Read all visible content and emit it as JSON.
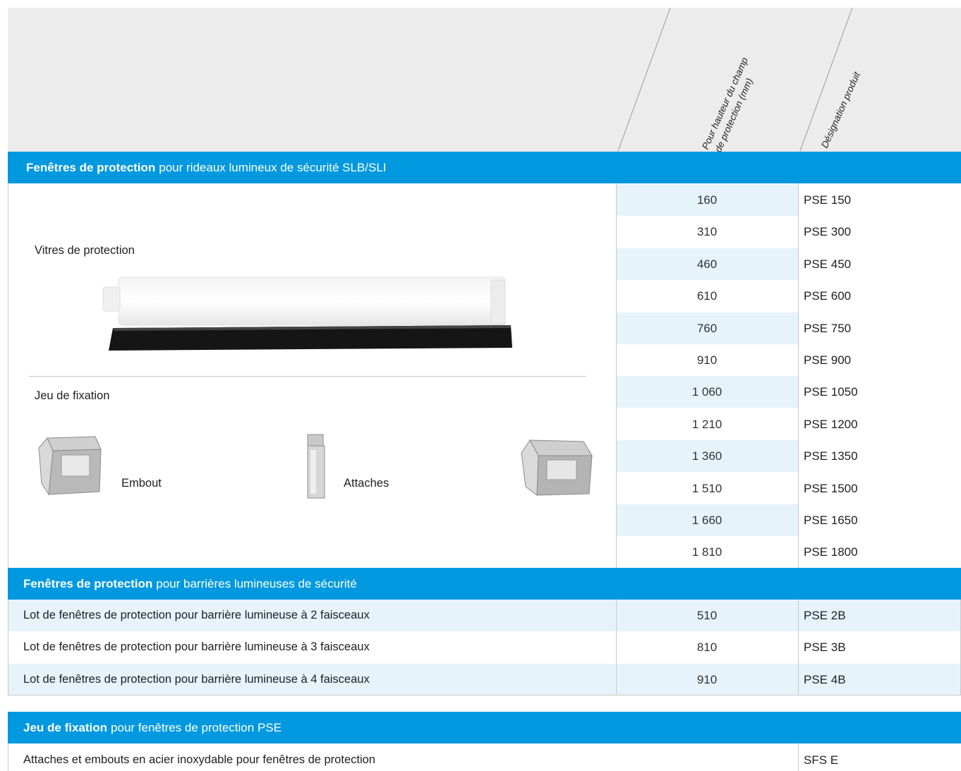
{
  "header": {
    "col_height_line1": "Pour hauteur du champ",
    "col_height_line2": "de protection (mm)",
    "col_designation": "Désignation produit"
  },
  "section1": {
    "title_bold": "Fenêtres de protection",
    "title_rest": "pour rideaux lumineux de sécurité SLB/SLI",
    "vitres_label": "Vitres de protection",
    "fixation_label": "Jeu de fixation",
    "embout_label": "Embout",
    "attaches_label": "Attaches",
    "rows": [
      {
        "height": "160",
        "code": "PSE 150"
      },
      {
        "height": "310",
        "code": "PSE 300"
      },
      {
        "height": "460",
        "code": "PSE 450"
      },
      {
        "height": "610",
        "code": "PSE 600"
      },
      {
        "height": "760",
        "code": "PSE 750"
      },
      {
        "height": "910",
        "code": "PSE 900"
      },
      {
        "height": "1 060",
        "code": "PSE 1050"
      },
      {
        "height": "1 210",
        "code": "PSE 1200"
      },
      {
        "height": "1 360",
        "code": "PSE 1350"
      },
      {
        "height": "1 510",
        "code": "PSE 1500"
      },
      {
        "height": "1 660",
        "code": "PSE 1650"
      },
      {
        "height": "1 810",
        "code": "PSE 1800"
      }
    ]
  },
  "section2": {
    "title_bold": "Fenêtres de protection",
    "title_rest": "pour barrières lumineuses de sécurité",
    "rows": [
      {
        "label": "Lot de fenêtres de protection pour barrière lumineuse à 2 faisceaux",
        "height": "510",
        "code": "PSE 2B"
      },
      {
        "label": "Lot de fenêtres de protection pour barrière lumineuse à 3 faisceaux",
        "height": "810",
        "code": "PSE 3B"
      },
      {
        "label": "Lot de fenêtres de protection pour barrière lumineuse à 4 faisceaux",
        "height": "910",
        "code": "PSE 4B"
      }
    ]
  },
  "section3": {
    "title_bold": "Jeu de fixation",
    "title_rest": "pour fenêtres de protection PSE",
    "rows": [
      {
        "label": "Attaches et embouts en acier inoxydable pour fenêtres de protection",
        "code": "SFS E"
      }
    ]
  },
  "colors": {
    "accent": "#0099e0",
    "shade": "#e6f3fb",
    "header_bg": "#ececec"
  }
}
